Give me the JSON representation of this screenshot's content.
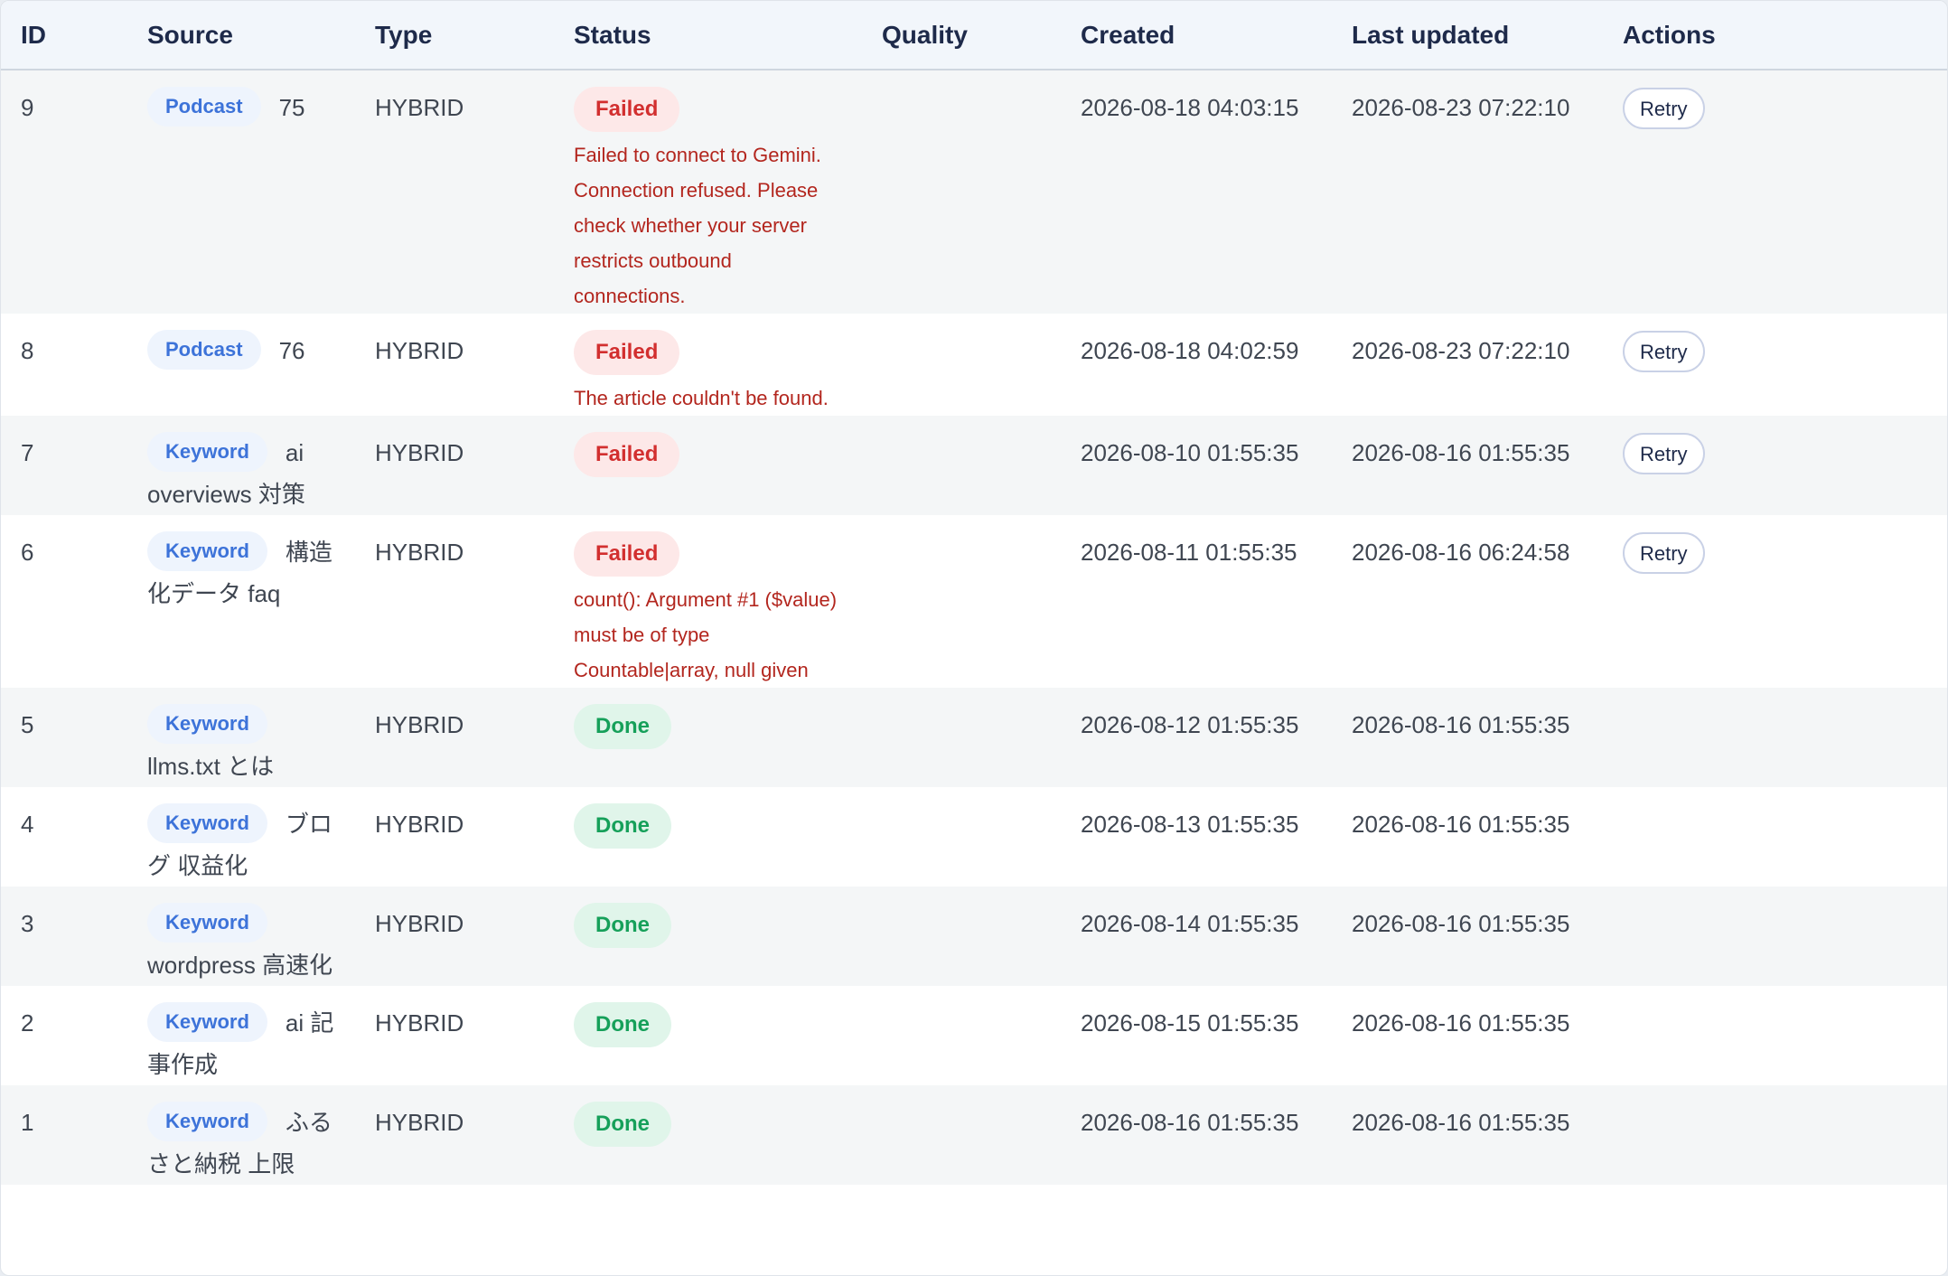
{
  "table": {
    "headers": {
      "id": "ID",
      "source": "Source",
      "type": "Type",
      "status": "Status",
      "quality": "Quality",
      "created": "Created",
      "updated": "Last updated",
      "actions": "Actions"
    },
    "rows": [
      {
        "id": "9",
        "source_badge": "Podcast",
        "source_text": "75",
        "type": "HYBRID",
        "status": "Failed",
        "status_kind": "failed",
        "error": "Failed to connect to Gemini. Connection refused. Please check whether your server restricts outbound connections.",
        "quality": "",
        "created": "2026-08-18 04:03:15",
        "updated": "2026-08-23 07:22:10",
        "action": "Retry"
      },
      {
        "id": "8",
        "source_badge": "Podcast",
        "source_text": "76",
        "type": "HYBRID",
        "status": "Failed",
        "status_kind": "failed",
        "error": "The article couldn't be found.",
        "quality": "",
        "created": "2026-08-18 04:02:59",
        "updated": "2026-08-23 07:22:10",
        "action": "Retry"
      },
      {
        "id": "7",
        "source_badge": "Keyword",
        "source_text": "ai overviews 対策",
        "type": "HYBRID",
        "status": "Failed",
        "status_kind": "failed",
        "error": "",
        "quality": "",
        "created": "2026-08-10 01:55:35",
        "updated": "2026-08-16 01:55:35",
        "action": "Retry"
      },
      {
        "id": "6",
        "source_badge": "Keyword",
        "source_text": "構造化データ faq",
        "type": "HYBRID",
        "status": "Failed",
        "status_kind": "failed",
        "error": "count(): Argument #1 ($value) must be of type Countable|array, null given",
        "quality": "",
        "created": "2026-08-11 01:55:35",
        "updated": "2026-08-16 06:24:58",
        "action": "Retry"
      },
      {
        "id": "5",
        "source_badge": "Keyword",
        "source_text": "llms.txt とは",
        "type": "HYBRID",
        "status": "Done",
        "status_kind": "done",
        "error": "",
        "quality": "",
        "created": "2026-08-12 01:55:35",
        "updated": "2026-08-16 01:55:35",
        "action": ""
      },
      {
        "id": "4",
        "source_badge": "Keyword",
        "source_text": "ブログ 収益化",
        "type": "HYBRID",
        "status": "Done",
        "status_kind": "done",
        "error": "",
        "quality": "",
        "created": "2026-08-13 01:55:35",
        "updated": "2026-08-16 01:55:35",
        "action": ""
      },
      {
        "id": "3",
        "source_badge": "Keyword",
        "source_text": "wordpress 高速化",
        "type": "HYBRID",
        "status": "Done",
        "status_kind": "done",
        "error": "",
        "quality": "",
        "created": "2026-08-14 01:55:35",
        "updated": "2026-08-16 01:55:35",
        "action": ""
      },
      {
        "id": "2",
        "source_badge": "Keyword",
        "source_text": "ai 記事作成",
        "type": "HYBRID",
        "status": "Done",
        "status_kind": "done",
        "error": "",
        "quality": "",
        "created": "2026-08-15 01:55:35",
        "updated": "2026-08-16 01:55:35",
        "action": ""
      },
      {
        "id": "1",
        "source_badge": "Keyword",
        "source_text": "ふるさと納税 上限",
        "type": "HYBRID",
        "status": "Done",
        "status_kind": "done",
        "error": "",
        "quality": "",
        "created": "2026-08-16 01:55:35",
        "updated": "2026-08-16 01:55:35",
        "action": ""
      }
    ]
  }
}
